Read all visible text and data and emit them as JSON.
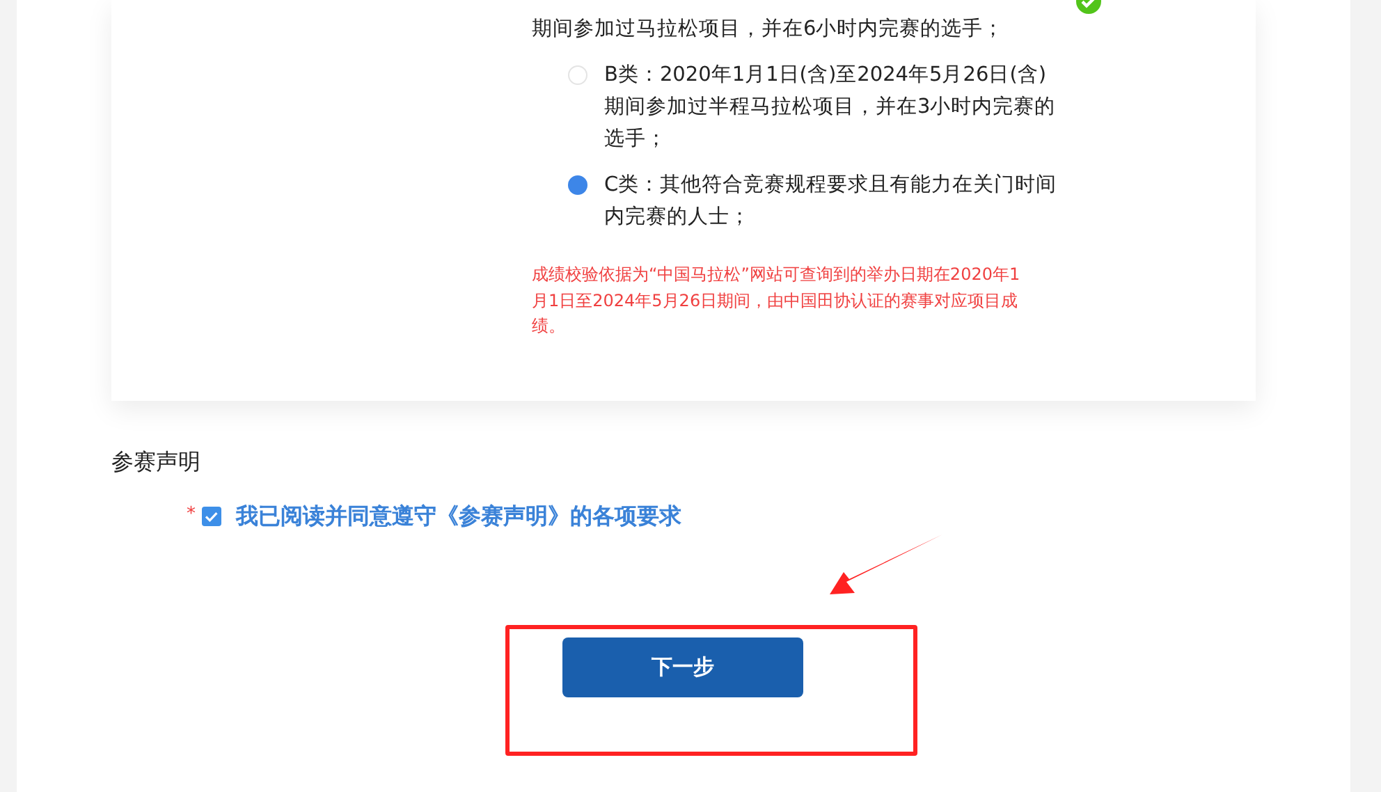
{
  "eligibility": {
    "valid": true,
    "options": [
      {
        "kind": "continued",
        "label": "期间参加过马拉松项目，并在6小时内完赛的选手；"
      },
      {
        "kind": "radio",
        "label": "B类：2020年1月1日(含)至2024年5月26日(含)期间参加过半程马拉松项目，并在3小时内完赛的选手；",
        "selected": false
      },
      {
        "kind": "radio",
        "label": "C类：其他符合竞赛规程要求且有能力在关门时间内完赛的人士；",
        "selected": true
      }
    ],
    "note": "成绩校验依据为“中国马拉松”网站可查询到的举办日期在2020年1月1日至2024年5月26日期间，由中国田协认证的赛事对应项目成绩。"
  },
  "declaration": {
    "title": "参赛声明",
    "required_mark": "*",
    "checked": true,
    "label": "我已阅读并同意遵守《参赛声明》的各项要求"
  },
  "next_button": {
    "label": "下一步"
  }
}
